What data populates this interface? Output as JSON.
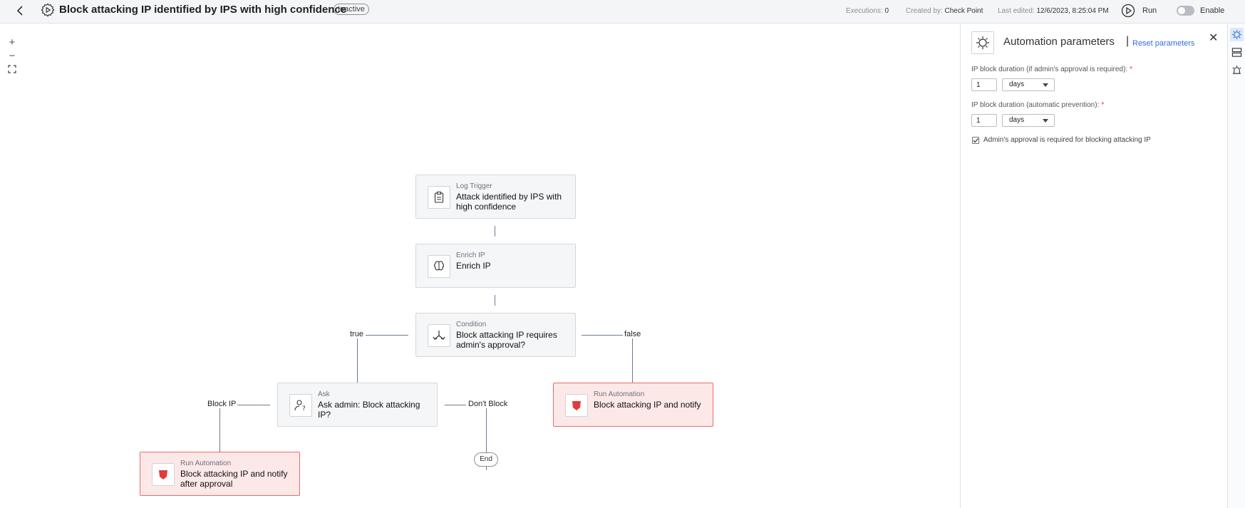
{
  "header": {
    "title": "Block attacking IP identified by IPS with high confidence",
    "status_badge": "Inactive",
    "executions_label": "Executions:",
    "executions_value": "0",
    "created_by_label": "Created by:",
    "created_by_value": "Check Point",
    "last_edited_label": "Last edited:",
    "last_edited_value": "12/6/2023, 8:25:04 PM",
    "run_label": "Run",
    "enable_label": "Enable",
    "enabled": false
  },
  "zoom": {
    "zoom_in": "+",
    "zoom_out": "−"
  },
  "flow": {
    "trigger": {
      "kind": "Log Trigger",
      "label": "Attack identified by IPS with high confidence"
    },
    "enrich": {
      "kind": "Enrich IP",
      "label": "Enrich IP"
    },
    "condition": {
      "kind": "Condition",
      "label": "Block attacking IP requires admin's approval?"
    },
    "ask": {
      "kind": "Ask",
      "label": "Ask admin: Block attacking IP?"
    },
    "run_false": {
      "kind": "Run Automation",
      "label": "Block attacking IP and notify"
    },
    "run_approved": {
      "kind": "Run Automation",
      "label": "Block attacking IP and notify after approval"
    },
    "edge_true": "true",
    "edge_false": "false",
    "edge_block": "Block IP",
    "edge_dont_block": "Don't Block",
    "end": "End"
  },
  "panel": {
    "title": "Automation parameters",
    "separator": "|",
    "reset_label": "Reset parameters",
    "close_glyph": "✕",
    "field1_label": "IP block duration (if admin's approval is required):",
    "field1_value": "1",
    "field1_unit": "days",
    "field2_label": "IP block duration (automatic prevention):",
    "field2_value": "1",
    "field2_unit": "days",
    "required_mark": "*",
    "checkbox_label": "Admin's approval is required for blocking attacking IP",
    "checkbox_checked": true
  },
  "icons": {
    "back": "chevron-left-icon",
    "automation": "gear-play-icon",
    "run": "play-circle-icon",
    "trigger": "clipboard-icon",
    "enrich": "brain-icon",
    "condition": "split-arrows-icon",
    "ask": "user-question-icon",
    "run_automation": "shield-icon",
    "rail": [
      "sun-gear-icon",
      "layout-icon",
      "alarm-icon"
    ]
  },
  "colors": {
    "accent": "#2f6fdf",
    "danger": "#e23b3b",
    "danger_bg": "#fde8e8",
    "connector": "#6e7b94"
  }
}
